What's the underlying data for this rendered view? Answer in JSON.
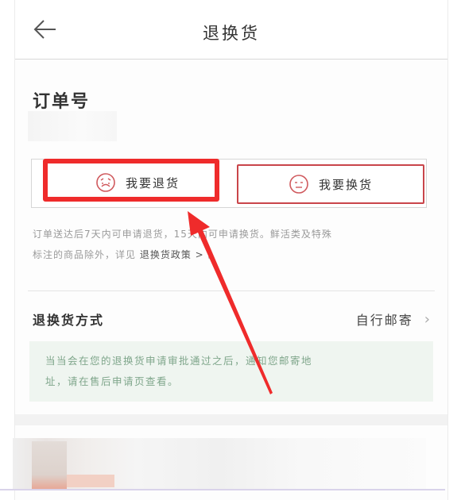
{
  "header": {
    "title": "退换货",
    "back_icon": "back-arrow-icon"
  },
  "order": {
    "label": "订单号"
  },
  "actions": {
    "return_label": "我要退货",
    "exchange_label": "我要换货",
    "return_icon": "sad-face-icon",
    "exchange_icon": "neutral-face-icon"
  },
  "notice": {
    "line1": "订单送达后7天内可申请退货，15天内可申请换货。鲜活类及特殊",
    "line2_prefix": "标注的商品除外，详见",
    "line2_link": "退换货政策 >",
    "line2_suffix": "。"
  },
  "method": {
    "label": "退换货方式",
    "value": "自行邮寄",
    "chevron_icon": "chevron-right-icon",
    "info_line1": "当当会在您的退换货申请审批通过之后，通知您邮寄地",
    "info_line2": "址，请在售后申请页查看。"
  },
  "colors": {
    "highlight": "#ef2b2b",
    "exchange_border": "#c9454a",
    "info_bg": "#eff5f0",
    "info_text": "#7fa68b"
  }
}
